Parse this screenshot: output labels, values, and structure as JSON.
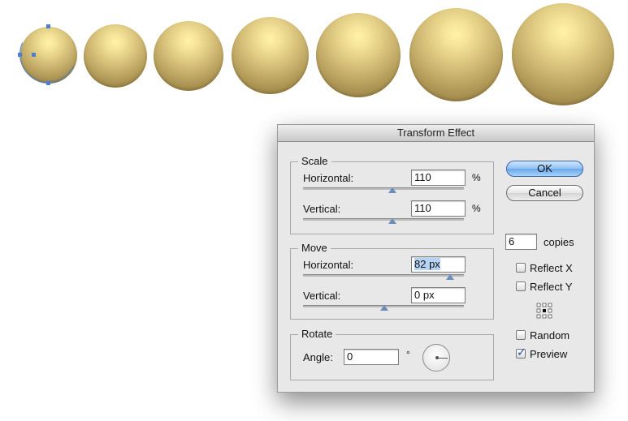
{
  "dialog": {
    "title": "Transform Effect",
    "scale": {
      "legend": "Scale",
      "horizontal_label": "Horizontal:",
      "horizontal_value": "110",
      "horizontal_unit": "%",
      "vertical_label": "Vertical:",
      "vertical_value": "110",
      "vertical_unit": "%"
    },
    "move": {
      "legend": "Move",
      "horizontal_label": "Horizontal:",
      "horizontal_value": "82 px",
      "vertical_label": "Vertical:",
      "vertical_value": "0 px"
    },
    "rotate": {
      "legend": "Rotate",
      "angle_label": "Angle:",
      "angle_value": "0",
      "degree_symbol": "°"
    },
    "buttons": {
      "ok": "OK",
      "cancel": "Cancel"
    },
    "copies": {
      "value": "6",
      "label": "copies"
    },
    "options": {
      "reflect_x": {
        "label": "Reflect X",
        "checked": false
      },
      "reflect_y": {
        "label": "Reflect Y",
        "checked": false
      },
      "random": {
        "label": "Random",
        "checked": false
      },
      "preview": {
        "label": "Preview",
        "checked": true
      }
    },
    "reference_point": "center"
  },
  "canvas": {
    "sphere_count": 7,
    "sphere_colors": {
      "highlight": "#fff2a8",
      "mid": "#cdb671",
      "edge": "#8b753b"
    },
    "selection_color": "#4a7fd4"
  },
  "icons": [
    "reference-point-grid-icon",
    "angle-dial-icon",
    "checkmark-icon"
  ]
}
